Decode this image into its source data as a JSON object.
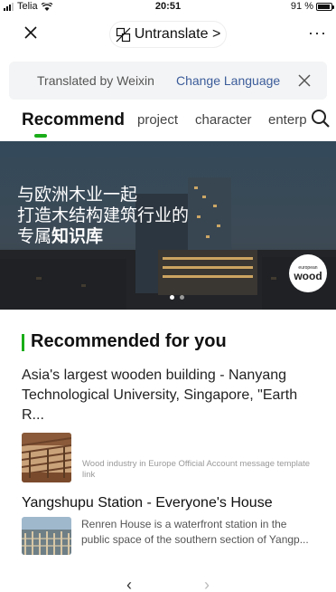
{
  "status_bar": {
    "carrier": "Telia",
    "time": "20:51",
    "battery": "91 %",
    "battery_level": 0.91
  },
  "top_bar": {
    "untranslate_label": "Untranslate >",
    "more_label": "···"
  },
  "banner": {
    "translated_by": "Translated by Weixin",
    "change_language": "Change Language"
  },
  "tabs": [
    "Recommend",
    "project",
    "character",
    "enterp"
  ],
  "hero": {
    "line1": "与欧洲木业一起",
    "line2": "打造木结构建筑行业的",
    "line3_prefix": "专属",
    "line3_bold": "知识库",
    "logo_small": "european",
    "logo_big": "wood"
  },
  "section_title": "Recommended for you",
  "articles": [
    {
      "title": "Asia's largest wooden building - Nanyang Technological University, Singapore, \"Earth R...",
      "meta": "Wood industry in Europe Official Account message template  link"
    },
    {
      "title": "Yangshupu Station - Everyone's House",
      "snippet": "Renren House is a waterfront station in the public space of the southern section of Yangp..."
    }
  ],
  "bottom_nav": {
    "back": "‹",
    "forward": "›"
  },
  "colors": {
    "accent": "#1aad19",
    "link": "#3b5c9a"
  }
}
